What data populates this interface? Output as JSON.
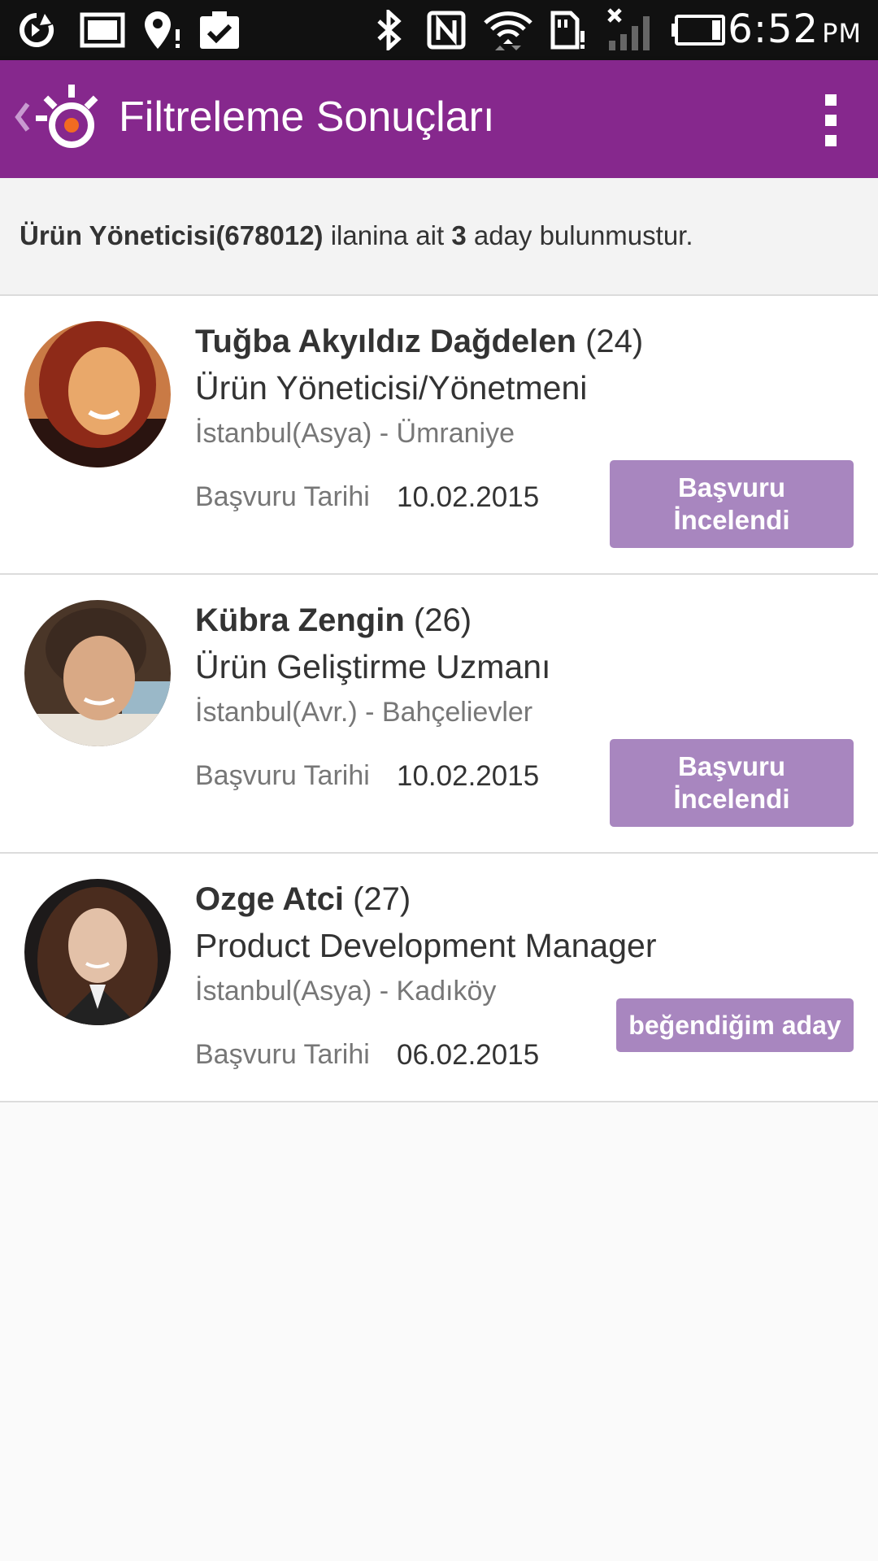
{
  "status_bar": {
    "time": "6:52",
    "ampm": "PM",
    "icons": [
      "sync-icon",
      "image-icon",
      "location-alert-icon",
      "clipboard-check-icon",
      "bluetooth-icon",
      "nfc-icon",
      "wifi-icon",
      "sd-card-alert-icon",
      "no-signal-icon",
      "battery-icon"
    ]
  },
  "app_bar": {
    "title": "Filtreleme Sonuçları",
    "back_icon": "chevron-left-icon",
    "logo_icon": "kariyer-logo-icon",
    "menu_icon": "overflow-menu-icon"
  },
  "summary": {
    "job_title": "Ürün Yöneticisi(678012)",
    "middle": " ilanina ait ",
    "count": "3",
    "suffix": " aday bulunmustur."
  },
  "candidates": [
    {
      "name": "Tuğba Akyıldız Dağdelen",
      "age": " (24)",
      "position": "Ürün Yöneticisi/Yönetmeni",
      "location": "İstanbul(Asya) - Ümraniye",
      "apply_label": "Başvuru Tarihi",
      "apply_date": "10.02.2015",
      "status_line1": "Başvuru",
      "status_line2": "İncelendi",
      "avatar_colors": [
        "#e9a86a",
        "#8e2a18",
        "#2a1410"
      ]
    },
    {
      "name": "Kübra Zengin",
      "age": " (26)",
      "position": "Ürün Geliştirme Uzmanı",
      "location": "İstanbul(Avr.) - Bahçelievler",
      "apply_label": "Başvuru Tarihi",
      "apply_date": "10.02.2015",
      "status_line1": "Başvuru",
      "status_line2": "İncelendi",
      "avatar_colors": [
        "#6b4a36",
        "#d9a985",
        "#3b2a20"
      ]
    },
    {
      "name": "Ozge Atci",
      "age": " (27)",
      "position": "Product Development Manager",
      "location": "İstanbul(Asya) - Kadıköy",
      "apply_label": "Başvuru Tarihi",
      "apply_date": "06.02.2015",
      "status_text": "beğendiğim aday",
      "avatar_colors": [
        "#1d1a1a",
        "#4a2c1e",
        "#e3c1a8"
      ]
    }
  ],
  "colors": {
    "primary": "#86288d",
    "button": "#a886bf",
    "logo_accent": "#f26b21"
  }
}
